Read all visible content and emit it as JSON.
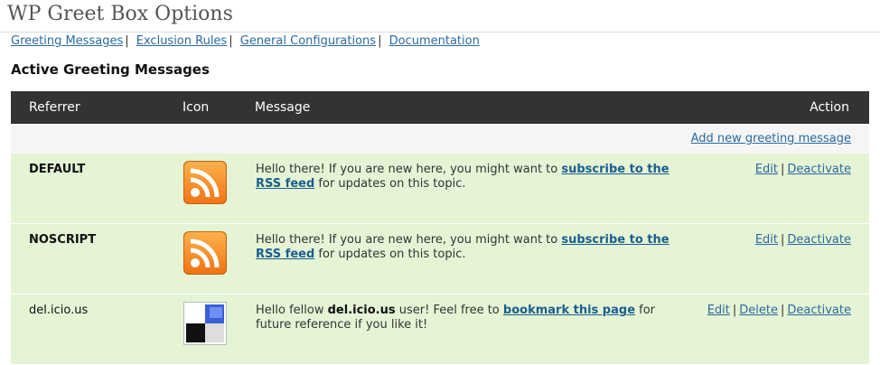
{
  "page": {
    "title": "WP Greet Box Options"
  },
  "subnav": {
    "items": [
      {
        "label": "Greeting Messages"
      },
      {
        "label": "Exclusion Rules"
      },
      {
        "label": "General Configurations"
      },
      {
        "label": "Documentation"
      }
    ],
    "separator": "|"
  },
  "section": {
    "title": "Active Greeting Messages"
  },
  "table": {
    "headers": {
      "referrer": "Referrer",
      "icon": "Icon",
      "message": "Message",
      "action": "Action"
    },
    "add_link": "Add new greeting message",
    "action_separator": "|",
    "rows": [
      {
        "referrer": "DEFAULT",
        "icon": "rss-feed-icon",
        "msg_pre": "Hello there! If you are new here, you might want to ",
        "msg_link": "subscribe to the RSS feed",
        "msg_post": " for updates on this topic.",
        "actions": [
          "Edit",
          "Deactivate"
        ]
      },
      {
        "referrer": "NOSCRIPT",
        "icon": "rss-feed-icon",
        "msg_pre": "Hello there! If you are new here, you might want to ",
        "msg_link": "subscribe to the RSS feed",
        "msg_post": " for updates on this topic.",
        "actions": [
          "Edit",
          "Deactivate"
        ]
      },
      {
        "referrer": "del.icio.us",
        "icon": "delicious-icon",
        "msg_pre": "Hello fellow ",
        "msg_bold": "del.icio.us",
        "msg_mid": " user! Feel free to ",
        "msg_link": "bookmark this page",
        "msg_post": " for future reference if you like it!",
        "actions": [
          "Edit",
          "Delete",
          "Deactivate"
        ]
      }
    ]
  },
  "colors": {
    "header_bg": "#333333",
    "row_bg": "#e5f4d5",
    "link": "#2a6aa0",
    "rss_orange": "#f27d16",
    "delicious_blue": "#3274d0"
  }
}
